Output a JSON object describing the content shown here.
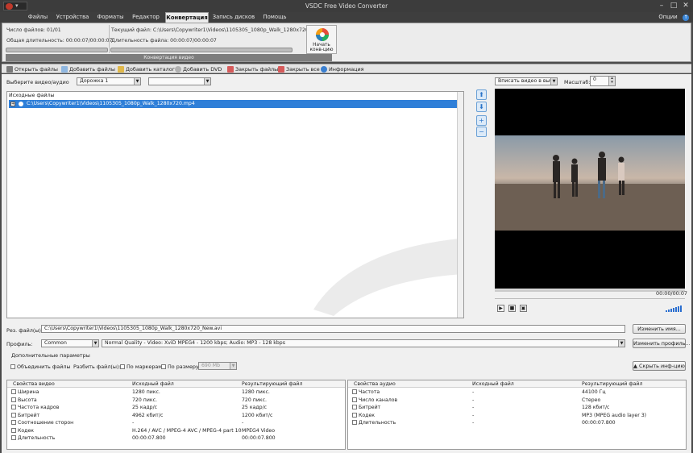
{
  "window": {
    "title": "VSDC Free Video Converter"
  },
  "menu": {
    "items": [
      "Файлы",
      "Устройства",
      "Форматы",
      "Редактор",
      "Конвертация",
      "Запись дисков",
      "Помощь"
    ],
    "options": "Опции"
  },
  "ribbon": {
    "file_count": "Число файлов: 01/01",
    "total_duration": "Общая длительность: 00:00:07/00:00:07",
    "current_file": "Текущий файл: C:\\Users\\Copywriter1\\Videos\\1105305_1080p_Walk_1280x720.mp4",
    "file_duration": "Длительность файла: 00:00:07/00:00:07",
    "group_label": "Конвертация видео",
    "start_button": "Начать конв-цию"
  },
  "toolbar": {
    "open": "Открыть файлы",
    "add_files": "Добавить файлы",
    "add_catalog": "Добавить каталог",
    "add_dvd": "Добавить DVD",
    "close_files": "Закрыть файлы",
    "close_all": "Закрыть все",
    "info": "Информация"
  },
  "source": {
    "select_label": "Выберите видео/аудио",
    "track": "Дорожка 1",
    "track2": "",
    "header": "Исходные файлы",
    "file": "C:\\Users\\Copywriter1\\Videos\\1105305_1080p_Walk_1280x720.mp4"
  },
  "preview": {
    "fit_mode": "Вписать видео в выбр",
    "scale_label": "Масштаб:",
    "scale_value": "0",
    "timecode": "00:00/00:07"
  },
  "output": {
    "result_label": "Рез. файл(ы):",
    "result_path": "C:\\Users\\Copywriter1\\Videos\\1105305_1080p_Walk_1280x720_New.avi",
    "rename_button": "Изменить имя...",
    "profile_label": "Профиль:",
    "profile_value": "Common",
    "quality_value": "Normal Quality - Video: XviD MPEG4 - 1200 kbps; Audio: MP3 - 128 kbps",
    "change_profile_button": "Изменить профиль...",
    "extra_params": "Дополнительные параметры",
    "merge_files": "Объединить файлы",
    "split_label": "Разбить файл(ы):",
    "by_markers": "По маркерам",
    "by_size": "По размеру:",
    "size_value": "690 Mb",
    "hide_info_button": "▲ Скрыть инф-цию"
  },
  "video_props": {
    "headers": [
      "Свойства видео",
      "Исходный файл",
      "Результирующий файл"
    ],
    "rows": [
      [
        "Ширина",
        "1280 пикс.",
        "1280 пикс."
      ],
      [
        "Высота",
        "720 пикс.",
        "720 пикс."
      ],
      [
        "Частота кадров",
        "25 кадр/с",
        "25 кадр/с"
      ],
      [
        "Битрейт",
        "4962 кбит/с",
        "1200 кбит/с"
      ],
      [
        "Соотношение сторон",
        "-",
        "-"
      ],
      [
        "Кодек",
        "H.264 / AVC / MPEG-4 AVC / MPEG-4 part 10",
        "MPEG4 Video"
      ],
      [
        "Длительность",
        "00:00:07.800",
        "00:00:07.800"
      ]
    ]
  },
  "audio_props": {
    "headers": [
      "Свойства аудио",
      "Исходный файл",
      "Результирующий файл"
    ],
    "rows": [
      [
        "Частота",
        "-",
        "44100 Гц"
      ],
      [
        "Число каналов",
        "-",
        "Стерео"
      ],
      [
        "Битрейт",
        "-",
        "128 кбит/с"
      ],
      [
        "Кодек",
        "-",
        "MP3 (MPEG audio layer 3)"
      ],
      [
        "Длительность",
        "-",
        "00:00:07.800"
      ]
    ]
  }
}
